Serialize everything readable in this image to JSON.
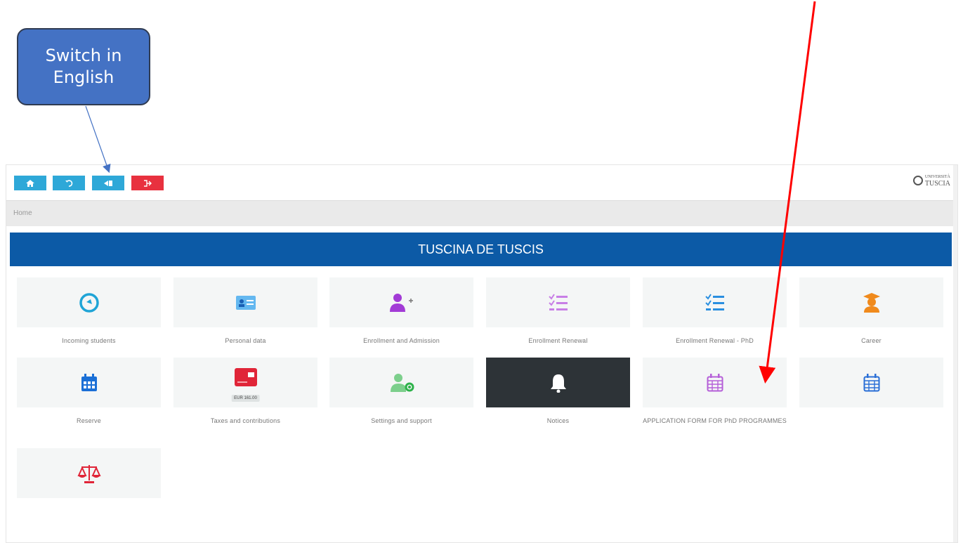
{
  "annotation": {
    "callout_text": "Switch in English"
  },
  "toolbar": {
    "buttons": [
      {
        "icon": "home-icon",
        "glyph": "⌂",
        "color": "#2ea8d8"
      },
      {
        "icon": "undo-icon",
        "glyph": "↺",
        "color": "#2ea8d8"
      },
      {
        "icon": "language-icon",
        "glyph": "◀▌",
        "color": "#2ea8d8"
      },
      {
        "icon": "logout-icon",
        "glyph": "↪",
        "color": "#e8313f"
      }
    ],
    "logo_small": "UNIVERSITÀ",
    "logo_main": "TUSCIA"
  },
  "breadcrumb": {
    "home": "Home"
  },
  "banner": {
    "title": "TUSCINA DE TUSCIS"
  },
  "tiles": [
    {
      "label": "Incoming students",
      "icon": "globe-icon"
    },
    {
      "label": "Personal data",
      "icon": "id-card-icon"
    },
    {
      "label": "Enrollment and Admission",
      "icon": "add-user-icon"
    },
    {
      "label": "Enrollment Renewal",
      "icon": "checklist-icon"
    },
    {
      "label": "Enrollment Renewal - PhD",
      "icon": "checklist-icon"
    },
    {
      "label": "Career",
      "icon": "graduate-icon"
    },
    {
      "label": "Reserve",
      "icon": "calendar-icon"
    },
    {
      "label": "Taxes and contributions",
      "icon": "credit-card-icon",
      "badge": "EUR 161.00"
    },
    {
      "label": "Settings and support",
      "icon": "user-settings-icon"
    },
    {
      "label": "Notices",
      "icon": "bell-icon"
    },
    {
      "label": "APPLICATION FORM FOR PhD PROGRAMMES",
      "icon": "calendar-icon"
    },
    {
      "label": "",
      "icon": "calendar-icon"
    },
    {
      "label": "",
      "icon": "scales-icon"
    }
  ],
  "colors": {
    "banner": "#0c5aa6",
    "toolbar_blue": "#2ea8d8",
    "toolbar_red": "#e8313f",
    "annotation_red": "#ff0000",
    "annotation_blue": "#4472c4"
  }
}
